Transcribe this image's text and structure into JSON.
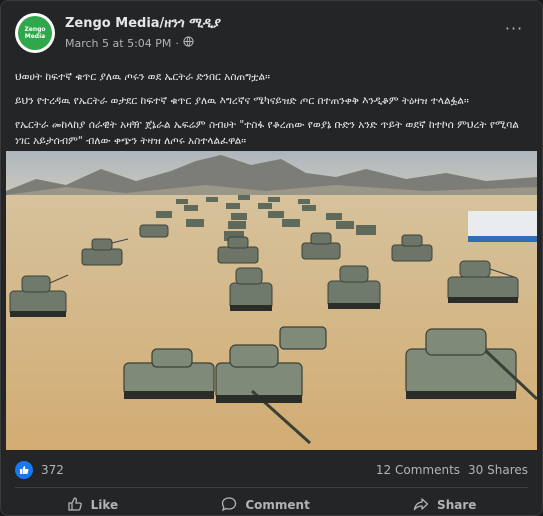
{
  "post": {
    "page_name": "Zengo Media/ዘንጎ ሚዲያ",
    "avatar_text": "Zengo Media",
    "timestamp": "March 5 at 5:04 PM",
    "separator": "·",
    "privacy_icon": "globe-icon",
    "more_label": "···",
    "paragraphs": [
      "ህወሀት ከፍተኛ ቁጥር ያለዉ ጦሩን ወደ ኤርትራ ድንበር አስጠግቷል።",
      "ይህን የተረዳዉ የኤርትራ ወታደር ከፍተኛ ቁጥር ያለዉ እግረኛና ሜካናይዝድ ጦር በተጠንቀቅ እንዲቆም ትዕዛዝ ተላልፏል።",
      "የኤርትራ መከላከያ ሰራዊት አዛዥ ጀኔራል ኤፍሬም ስብሀት \"ተስፋ የቆረጠው የወያኔ ቡድን አንድ ጥይት ወደኛ ከተኮሰ ምህረት የሚባል ነገር አይታሰብም\" ብለው ቀጭን ትዛዝ ለጦሩ አስተላልፈዋል።"
    ]
  },
  "stats": {
    "reactions": "372",
    "comments": "12 Comments",
    "shares": "30 Shares"
  },
  "actions": {
    "like": "Like",
    "comment": "Comment",
    "share": "Share"
  },
  "colors": {
    "card_bg": "#242526",
    "accent": "#1877f2",
    "muted_text": "#b0b3b8",
    "sand": "#d9b98a"
  }
}
